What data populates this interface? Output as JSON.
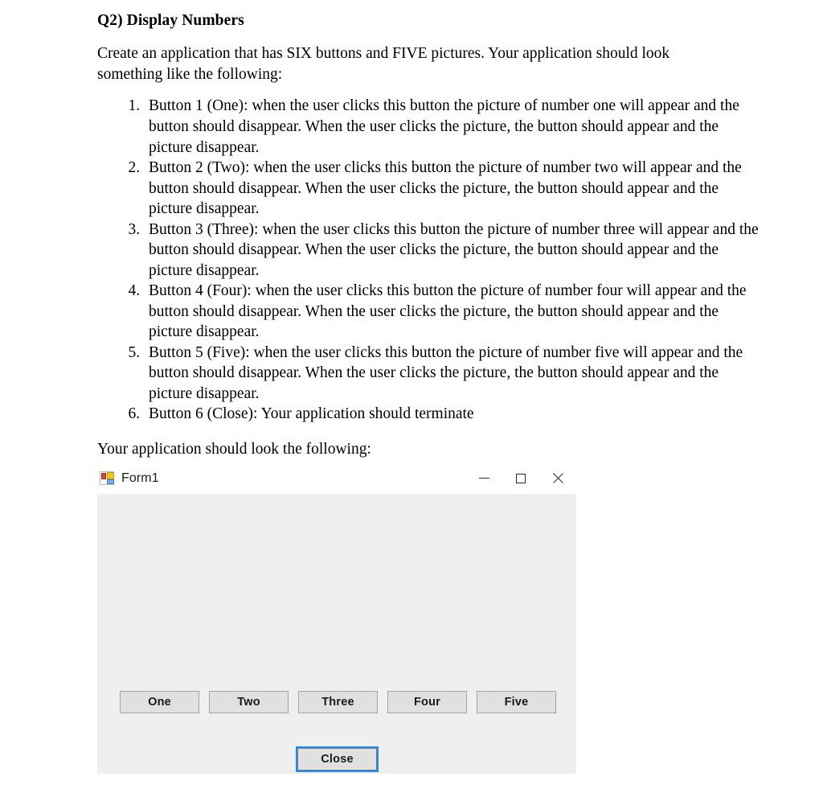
{
  "document": {
    "heading": "Q2) Display Numbers",
    "intro": "Create an application that has SIX buttons and FIVE pictures. Your application should look something like the following:",
    "requirements": [
      "Button 1 (One): when the user clicks this button the picture of number one will appear and the button should disappear. When the user clicks the picture, the button should appear and the picture disappear.",
      "Button 2 (Two): when the user clicks this button the picture of number two will appear and the button should disappear. When the user clicks the picture, the button should appear and the picture disappear.",
      "Button 3 (Three): when the user clicks this button the picture of number three will appear and the button should disappear. When the user clicks the picture, the button should appear and the picture disappear.",
      "Button 4 (Four): when the user clicks this button the picture of number four will appear and the button should disappear. When the user clicks the picture, the button should appear and the picture disappear.",
      "Button 5 (Five): when the user clicks this button the picture of number five will appear and the button should disappear. When the user clicks the picture, the button should appear and the picture disappear.",
      "Button 6 (Close): Your application should terminate"
    ],
    "closing": "Your application should look the following:"
  },
  "form_window": {
    "title": "Form1",
    "icon": "winforms-designer-icon",
    "window_controls": {
      "minimize": "minimize-icon",
      "maximize": "maximize-icon",
      "close": "close-icon"
    },
    "buttons": [
      {
        "label": "One"
      },
      {
        "label": "Two"
      },
      {
        "label": "Three"
      },
      {
        "label": "Four"
      },
      {
        "label": "Five"
      }
    ],
    "close_button": {
      "label": "Close",
      "focused": true
    },
    "colors": {
      "body_background": "#efefef",
      "titlebar_background": "#ffffff",
      "button_face": "#e0e0e0",
      "button_border": "#a3a3a3",
      "focus_ring": "#1d8bf1",
      "text": "#1a1a1a"
    }
  }
}
